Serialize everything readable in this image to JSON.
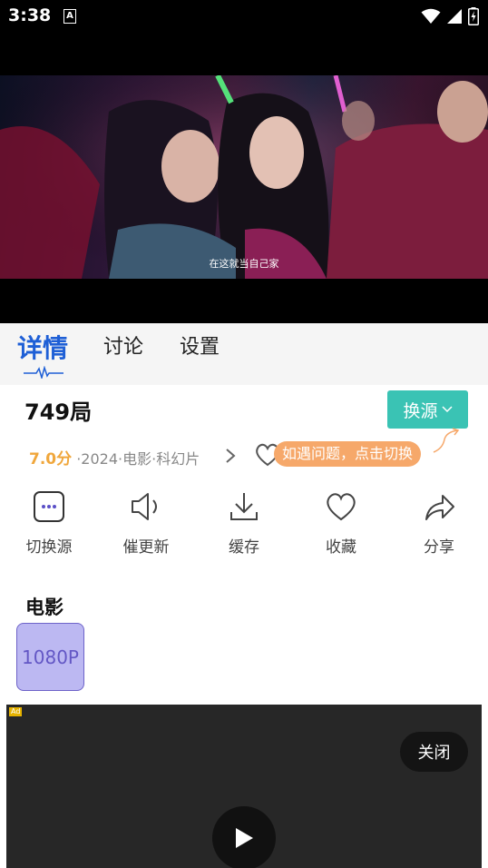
{
  "status_bar": {
    "time": "3:38",
    "notification_icon": "A"
  },
  "video": {
    "subtitle": "在这就当自己家"
  },
  "tabs": [
    {
      "label": "详情"
    },
    {
      "label": "讨论"
    },
    {
      "label": "设置"
    }
  ],
  "detail": {
    "title": "749局",
    "switch_source_label": "换源",
    "score": "7.0分",
    "meta": "·2024·电影·科幻片",
    "tip": "如遇问题，点击切换"
  },
  "actions": [
    {
      "label": "切换源",
      "icon": "source-switch-icon"
    },
    {
      "label": "催更新",
      "icon": "speaker-icon"
    },
    {
      "label": "缓存",
      "icon": "download-icon"
    },
    {
      "label": "收藏",
      "icon": "heart-icon"
    },
    {
      "label": "分享",
      "icon": "share-icon"
    }
  ],
  "movie_section": {
    "title": "电影",
    "quality": "1080P"
  },
  "ad": {
    "badge": "Ad",
    "close_label": "关闭"
  },
  "colors": {
    "accent_blue": "#1e5fd6",
    "teal": "#3ac3b4",
    "score_orange": "#f0a73c",
    "tip_orange": "#f6a86a",
    "chip_purple": "#bcb8f2"
  }
}
